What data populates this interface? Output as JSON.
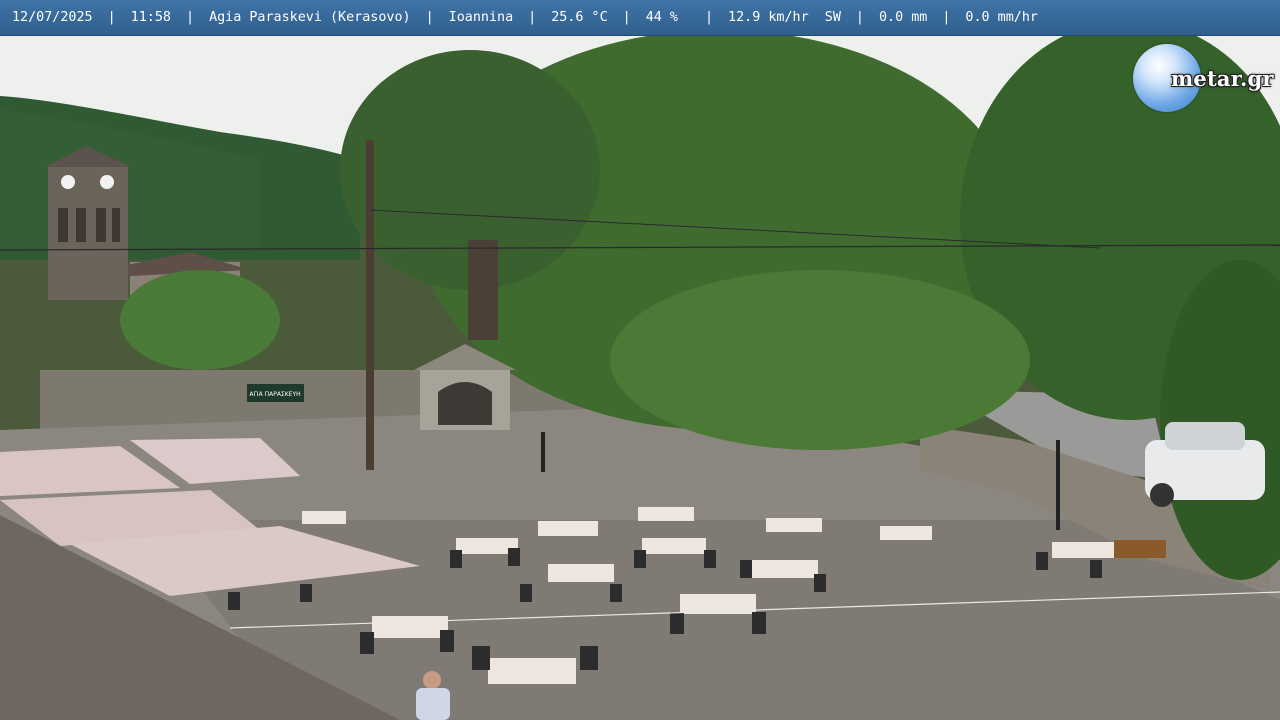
{
  "info_bar": {
    "date": "12/07/2025",
    "time": "11:58",
    "location": "Agia Paraskevi (Kerasovo)",
    "region": "Ioannina",
    "temperature": "25.6 °C",
    "humidity": "44 %",
    "wind": "12.9 km/hr  SW",
    "rain": "0.0 mm",
    "rain_rate": "0.0 mm/hr",
    "separator": "|"
  },
  "logo": {
    "text": "metar.gr"
  },
  "scene": {
    "sign_text": "ΑΓΙΑ ΠΑΡΑΣΚΕΥΗ",
    "clock_faces": 2,
    "colors": {
      "sky": "#eef0ee",
      "mountain": "#2f5a33",
      "foliage": "#3f6b2e",
      "plaza": "#8c8680",
      "stone_wall": "#8a8478",
      "awning": "#d9c6c4",
      "roof": "#6e6660",
      "table": "#ece6df",
      "chair": "#2c2c2c"
    }
  }
}
